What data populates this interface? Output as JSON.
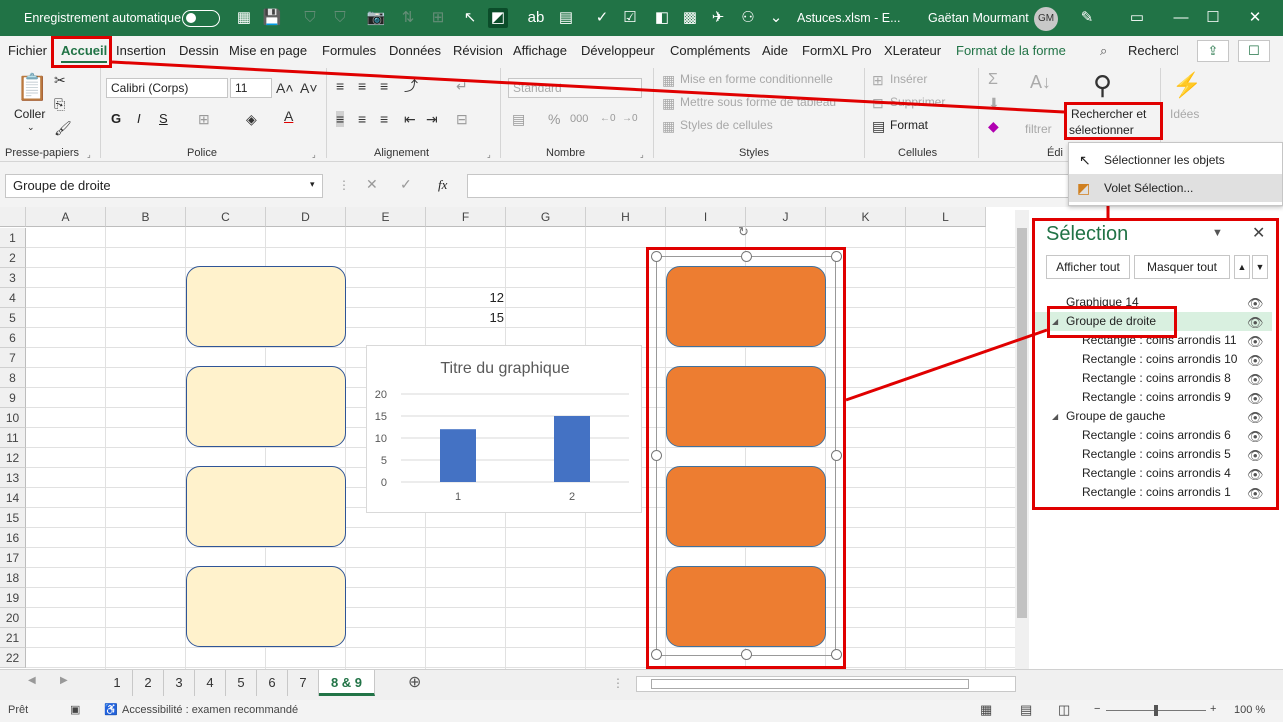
{
  "titlebar": {
    "autosave_label": "Enregistrement automatique",
    "file_title": "Astuces.xlsm  -  E...",
    "user_name": "Gaëtan Mourmant",
    "user_initials": "GM"
  },
  "tabs": [
    "Fichier",
    "Accueil",
    "Insertion",
    "Dessin",
    "Mise en page",
    "Formules",
    "Données",
    "Révision",
    "Affichage",
    "Développeur",
    "Compléments",
    "Aide",
    "FormXL Pro",
    "XLerateur",
    "Format de la forme"
  ],
  "active_tab": "Accueil",
  "search_label": "Rechercher",
  "ribbon": {
    "paste_label": "Coller",
    "font_name": "Calibri (Corps)",
    "font_size": "11",
    "bold": "G",
    "italic": "I",
    "underline": "S",
    "number_format": "Standard",
    "cond_format": "Mise en forme conditionnelle",
    "table_format": "Mettre sous forme de tableau",
    "cell_styles": "Styles de cellules",
    "insert": "Insérer",
    "delete": "Supprimer",
    "format": "Format",
    "find_select_line1": "Rechercher et",
    "find_select_line2": "sélectionner",
    "filter": "filtrer",
    "ideas": "Idées",
    "groups": {
      "clipboard": "Presse-papiers",
      "font": "Police",
      "alignment": "Alignement",
      "number": "Nombre",
      "styles": "Styles",
      "cells": "Cellules",
      "editing": "Édi"
    }
  },
  "dropdown_menu": {
    "select_objects": "Sélectionner les objets",
    "selection_pane": "Volet Sélection..."
  },
  "namebox": "Groupe de droite",
  "fx_label": "fx",
  "columns": [
    "A",
    "B",
    "C",
    "D",
    "E",
    "F",
    "G",
    "H",
    "I",
    "J",
    "K",
    "L"
  ],
  "rows": [
    "1",
    "2",
    "3",
    "4",
    "5",
    "6",
    "7",
    "8",
    "9",
    "10",
    "11",
    "12",
    "13",
    "14",
    "15",
    "16",
    "17",
    "18",
    "19",
    "20",
    "21",
    "22"
  ],
  "cells": {
    "F4": "12",
    "F5": "15"
  },
  "chart_data": {
    "type": "bar",
    "title": "Titre du graphique",
    "categories": [
      "1",
      "2"
    ],
    "values": [
      12,
      15
    ],
    "ylim": [
      0,
      20
    ],
    "yticks": [
      "0",
      "5",
      "10",
      "15",
      "20"
    ],
    "color": "#4472c4",
    "grid": true
  },
  "selection_pane": {
    "title": "Sélection",
    "show_all": "Afficher tout",
    "hide_all": "Masquer tout",
    "items": [
      {
        "label": "Graphique 14",
        "level": 0
      },
      {
        "label": "Groupe de droite",
        "level": 0,
        "expanded": true,
        "selected": true
      },
      {
        "label": "Rectangle : coins arrondis 11",
        "level": 1
      },
      {
        "label": "Rectangle : coins arrondis 10",
        "level": 1
      },
      {
        "label": "Rectangle : coins arrondis 8",
        "level": 1
      },
      {
        "label": "Rectangle : coins arrondis 9",
        "level": 1
      },
      {
        "label": "Groupe de gauche",
        "level": 0,
        "expanded": true
      },
      {
        "label": "Rectangle : coins arrondis 6",
        "level": 1
      },
      {
        "label": "Rectangle : coins arrondis 5",
        "level": 1
      },
      {
        "label": "Rectangle : coins arrondis 4",
        "level": 1
      },
      {
        "label": "Rectangle : coins arrondis 1",
        "level": 1
      }
    ]
  },
  "sheet_tabs": [
    "1",
    "2",
    "3",
    "4",
    "5",
    "6",
    "7",
    "8 & 9"
  ],
  "active_sheet": "8 & 9",
  "status": {
    "ready": "Prêt",
    "accessibility": "Accessibilité : examen recommandé",
    "zoom": "100 %"
  },
  "colors": {
    "excel_green": "#217346",
    "highlight_red": "#e00000",
    "shape_orange": "#ed7d31",
    "shape_cream": "#fff2cc"
  }
}
